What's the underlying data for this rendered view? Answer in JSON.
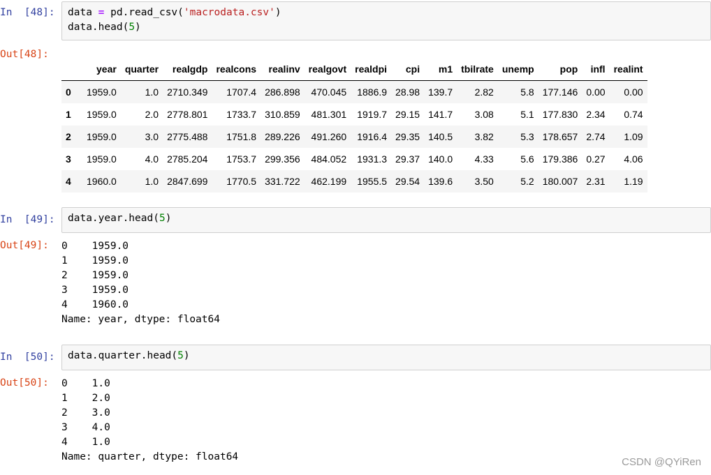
{
  "cells": [
    {
      "in_prompt": "In  [48]:",
      "code_lines": [
        [
          {
            "t": "data "
          },
          {
            "t": "=",
            "c": "op"
          },
          {
            "t": " pd.read_csv("
          },
          {
            "t": "'macrodata.csv'",
            "c": "str"
          },
          {
            "t": ")"
          }
        ],
        [
          {
            "t": "data.head("
          },
          {
            "t": "5",
            "c": "num"
          },
          {
            "t": ")"
          }
        ]
      ],
      "out_prompt": "Out[48]:"
    },
    {
      "in_prompt": "In  [49]:",
      "code_lines": [
        [
          {
            "t": "data.year.head("
          },
          {
            "t": "5",
            "c": "num"
          },
          {
            "t": ")"
          }
        ]
      ],
      "out_prompt": "Out[49]:",
      "output_lines": [
        "0    1959.0",
        "1    1959.0",
        "2    1959.0",
        "3    1959.0",
        "4    1960.0",
        "Name: year, dtype: float64"
      ]
    },
    {
      "in_prompt": "In  [50]:",
      "code_lines": [
        [
          {
            "t": "data.quarter.head("
          },
          {
            "t": "5",
            "c": "num"
          },
          {
            "t": ")"
          }
        ]
      ],
      "out_prompt": "Out[50]:",
      "output_lines": [
        "0    1.0",
        "1    2.0",
        "2    3.0",
        "3    4.0",
        "4    1.0",
        "Name: quarter, dtype: float64"
      ]
    }
  ],
  "dataframe": {
    "columns": [
      "",
      "year",
      "quarter",
      "realgdp",
      "realcons",
      "realinv",
      "realgovt",
      "realdpi",
      "cpi",
      "m1",
      "tbilrate",
      "unemp",
      "pop",
      "infl",
      "realint"
    ],
    "rows": [
      [
        "0",
        "1959.0",
        "1.0",
        "2710.349",
        "1707.4",
        "286.898",
        "470.045",
        "1886.9",
        "28.98",
        "139.7",
        "2.82",
        "5.8",
        "177.146",
        "0.00",
        "0.00"
      ],
      [
        "1",
        "1959.0",
        "2.0",
        "2778.801",
        "1733.7",
        "310.859",
        "481.301",
        "1919.7",
        "29.15",
        "141.7",
        "3.08",
        "5.1",
        "177.830",
        "2.34",
        "0.74"
      ],
      [
        "2",
        "1959.0",
        "3.0",
        "2775.488",
        "1751.8",
        "289.226",
        "491.260",
        "1916.4",
        "29.35",
        "140.5",
        "3.82",
        "5.3",
        "178.657",
        "2.74",
        "1.09"
      ],
      [
        "3",
        "1959.0",
        "4.0",
        "2785.204",
        "1753.7",
        "299.356",
        "484.052",
        "1931.3",
        "29.37",
        "140.0",
        "4.33",
        "5.6",
        "179.386",
        "0.27",
        "4.06"
      ],
      [
        "4",
        "1960.0",
        "1.0",
        "2847.699",
        "1770.5",
        "331.722",
        "462.199",
        "1955.5",
        "29.54",
        "139.6",
        "3.50",
        "5.2",
        "180.007",
        "2.31",
        "1.19"
      ]
    ]
  },
  "watermark": "CSDN @QYiRen"
}
